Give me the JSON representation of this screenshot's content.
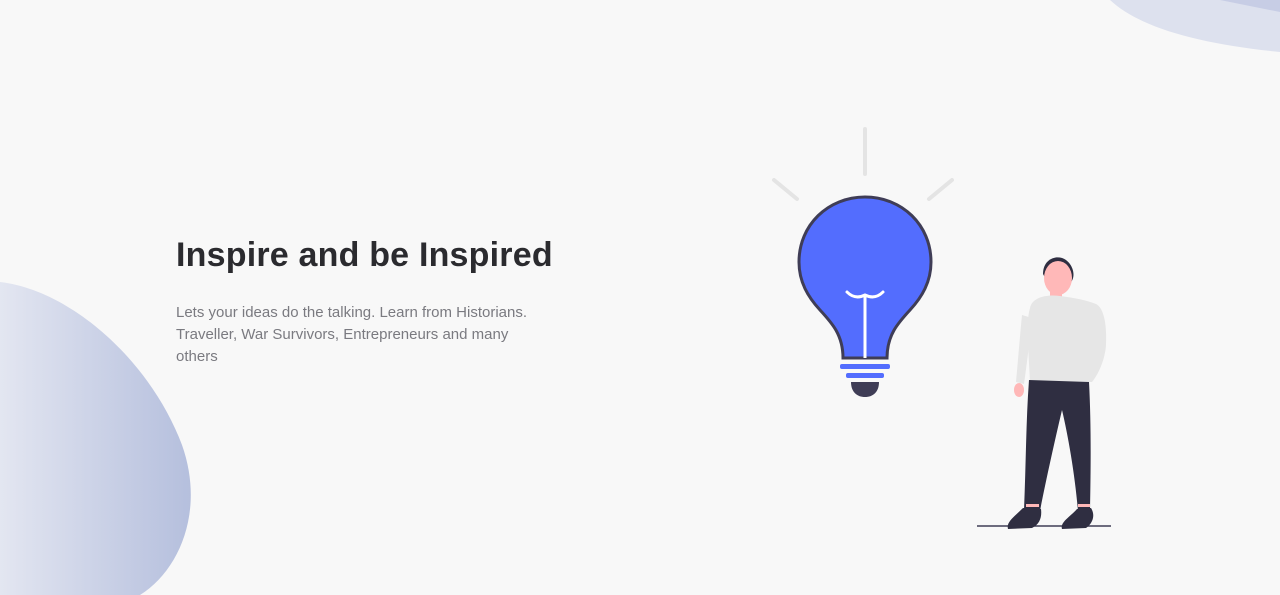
{
  "hero": {
    "title": "Inspire and be Inspired",
    "description": "Lets your ideas do the talking. Learn from Historians. Traveller, War Survivors, Entrepreneurs and many others"
  },
  "illustration": {
    "icons": [
      "lightbulb-icon",
      "person-figure"
    ]
  },
  "colors": {
    "background": "#f8f8f8",
    "bulb": "#536dfe",
    "bulb_outline": "#3f3d56",
    "blob": "#b9c2df",
    "title": "#2b2b2f",
    "text": "#7a7a80",
    "shirt": "#e6e6e6",
    "pants": "#2f2e41",
    "skin": "#ffb8b8"
  }
}
